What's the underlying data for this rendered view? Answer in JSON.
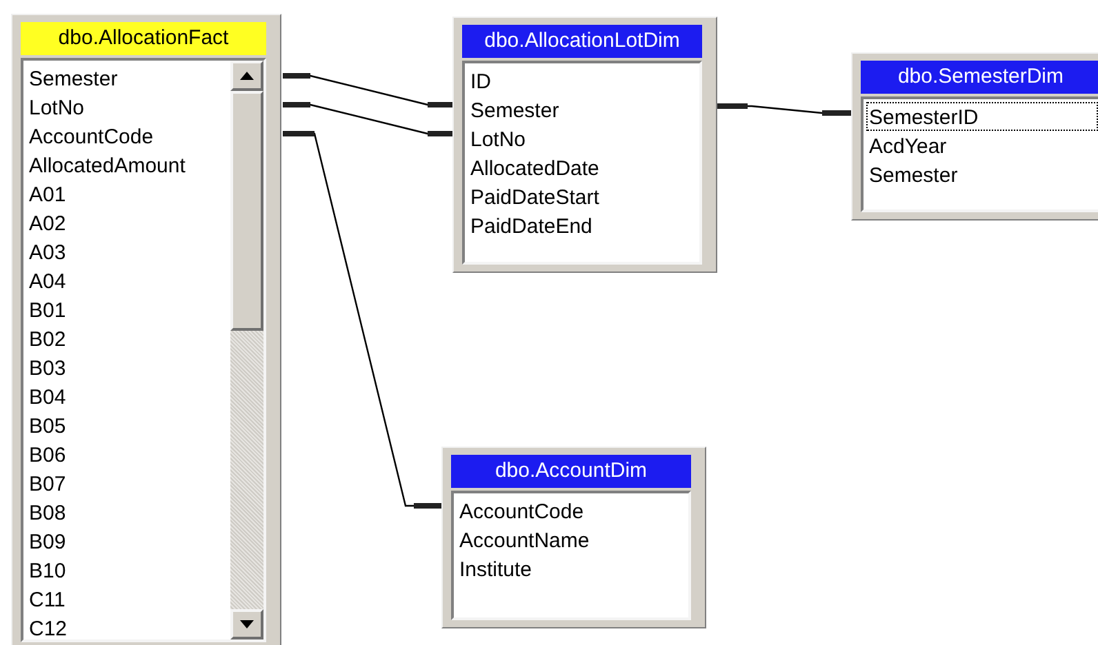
{
  "tables": [
    {
      "title": "dbo.AllocationFact",
      "selected": true,
      "scrollable": true,
      "columns": [
        {
          "name": "Semester",
          "focused": false
        },
        {
          "name": "LotNo",
          "focused": false
        },
        {
          "name": "AccountCode",
          "focused": false
        },
        {
          "name": "AllocatedAmount",
          "focused": false
        },
        {
          "name": "A01",
          "focused": false
        },
        {
          "name": "A02",
          "focused": false
        },
        {
          "name": "A03",
          "focused": false
        },
        {
          "name": "A04",
          "focused": false
        },
        {
          "name": "B01",
          "focused": false
        },
        {
          "name": "B02",
          "focused": false
        },
        {
          "name": "B03",
          "focused": false
        },
        {
          "name": "B04",
          "focused": false
        },
        {
          "name": "B05",
          "focused": false
        },
        {
          "name": "B06",
          "focused": false
        },
        {
          "name": "B07",
          "focused": false
        },
        {
          "name": "B08",
          "focused": false
        },
        {
          "name": "B09",
          "focused": false
        },
        {
          "name": "B10",
          "focused": false
        },
        {
          "name": "C11",
          "focused": false
        },
        {
          "name": "C12",
          "focused": false
        }
      ]
    },
    {
      "title": "dbo.AllocationLotDim",
      "selected": false,
      "scrollable": false,
      "columns": [
        {
          "name": "ID",
          "focused": false
        },
        {
          "name": "Semester",
          "focused": false
        },
        {
          "name": "LotNo",
          "focused": false
        },
        {
          "name": "AllocatedDate",
          "focused": false
        },
        {
          "name": "PaidDateStart",
          "focused": false
        },
        {
          "name": "PaidDateEnd",
          "focused": false
        }
      ]
    },
    {
      "title": "dbo.SemesterDim",
      "selected": false,
      "scrollable": false,
      "columns": [
        {
          "name": "SemesterID",
          "focused": true
        },
        {
          "name": "AcdYear",
          "focused": false
        },
        {
          "name": "Semester",
          "focused": false
        }
      ]
    },
    {
      "title": "dbo.AccountDim",
      "selected": false,
      "scrollable": false,
      "columns": [
        {
          "name": "AccountCode",
          "focused": false
        },
        {
          "name": "AccountName",
          "focused": false
        },
        {
          "name": "Institute",
          "focused": false
        }
      ]
    }
  ]
}
